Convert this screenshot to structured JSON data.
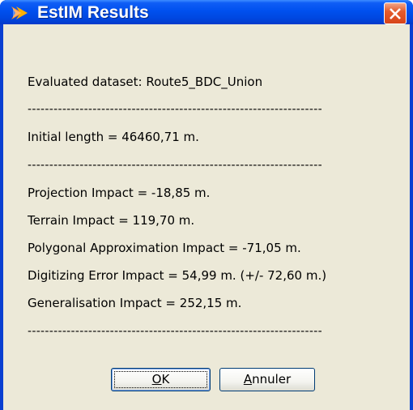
{
  "window": {
    "title": "EstIM Results",
    "title_icon": "arrow-logo-icon",
    "close_icon": "close-icon"
  },
  "content": {
    "dataset_line": "Evaluated dataset: Route5_BDC_Union",
    "separator": "--------------------------------------------------------------------",
    "initial_length": "Initial length = 46460,71 m.",
    "projection_impact": "Projection Impact = -18,85 m.",
    "terrain_impact": "Terrain Impact = 119,70 m.",
    "polygonal_impact": "Polygonal Approximation Impact = -71,05 m.",
    "digitizing_impact": "Digitizing Error Impact = 54,99 m. (+/- 72,60 m.)",
    "generalisation_impact": "Generalisation Impact = 252,15 m."
  },
  "buttons": {
    "ok_mnemonic": "O",
    "ok_rest": "K",
    "cancel_mnemonic": "A",
    "cancel_rest": "nnuler"
  },
  "colors": {
    "titlebar": "#0050ee",
    "dialog_bg": "#ece9d8",
    "close_button": "#d7451a"
  }
}
